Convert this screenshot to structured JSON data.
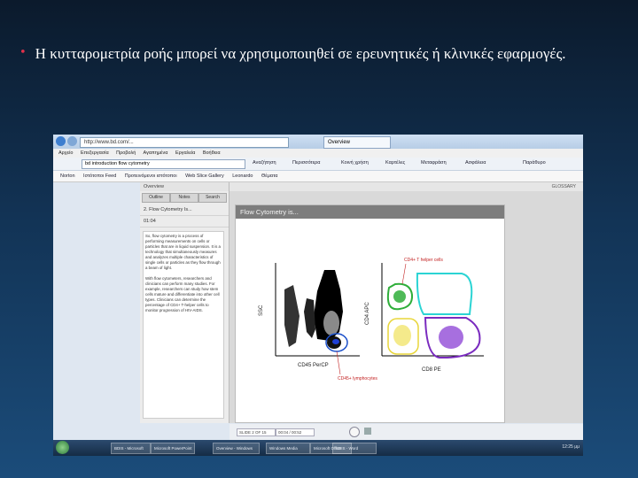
{
  "slide": {
    "bullet": "•",
    "text": "Η κυτταρομετρία ροής μπορεί να χρησιμοποιηθεί σε ερευνητικές ή κλινικές εφαρμογές."
  },
  "browser": {
    "url": "http://www.bd.com/...",
    "tab_label": "Overview",
    "menu": [
      "Αρχείο",
      "Επεξεργασία",
      "Προβολή",
      "Αγαπημένα",
      "Εργαλεία",
      "Βοήθεια"
    ],
    "search_value": "bd introduction flow cytometry",
    "toolbar_items": [
      "Αναζήτηση",
      "Περισσότερα",
      "Κοινή χρήση",
      "Καρτέλες",
      "Μεταφράση",
      "Ασφάλεια",
      "Παράθυρο"
    ],
    "favorites": [
      "Norton",
      "Ιστότοποι Feed",
      "Προτεινόμενοι ιστότοποι",
      "Web Slice Gallery",
      "Leonardo",
      "Θέματα"
    ]
  },
  "course": {
    "panel_title": "Overview",
    "glossary": "GLOSSARY",
    "tabs": [
      "Outline",
      "Notes",
      "Search"
    ],
    "current_item": "2. Flow Cytometry Is...",
    "time": "01:04",
    "notes_p1": "So, flow cytometry is a process of performing measurements on cells or particles that are in liquid suspension. It is a technology that simultaneously measures and analyzes multiple characteristics of single cells or particles as they flow through a beam of light.",
    "notes_p2": "With flow cytometers, researchers and clinicians can perform many studies. For example, researchers can study how stem cells mature and differentiate into other cell types. Clinicians can determine the percentage of CD4+ T-helper cells to monitor progression of HIV-AIDS.",
    "slide_title": "Flow Cytometry is...",
    "slide_counter": "SLIDE 2 OF 15",
    "slide_time": "00:04 / 00:52",
    "label_cd4_helper": "CD4+ T helper cells",
    "label_ssc": "SSC",
    "label_cd45": "CD45 PerCP",
    "label_lymph": "CD45+ lymphocytes",
    "label_cd4_apc": "CD4 APC",
    "label_cd8": "CD8 PE"
  },
  "taskbar": {
    "items": [
      "BDIS - Microsoft",
      "Microsoft PowerPoint",
      "Overview - Windows",
      "Windows Media",
      "Microsoft Office",
      "BDIS - Word"
    ],
    "clock": "12:25 μμ"
  },
  "colors": {
    "cd4_gate": "#2fae3a",
    "cd8_gate": "#7a2bbf",
    "double_neg_gate": "#2bd4d4",
    "lymph_gate": "#1a4fc9",
    "label_red": "#c21f1f"
  }
}
